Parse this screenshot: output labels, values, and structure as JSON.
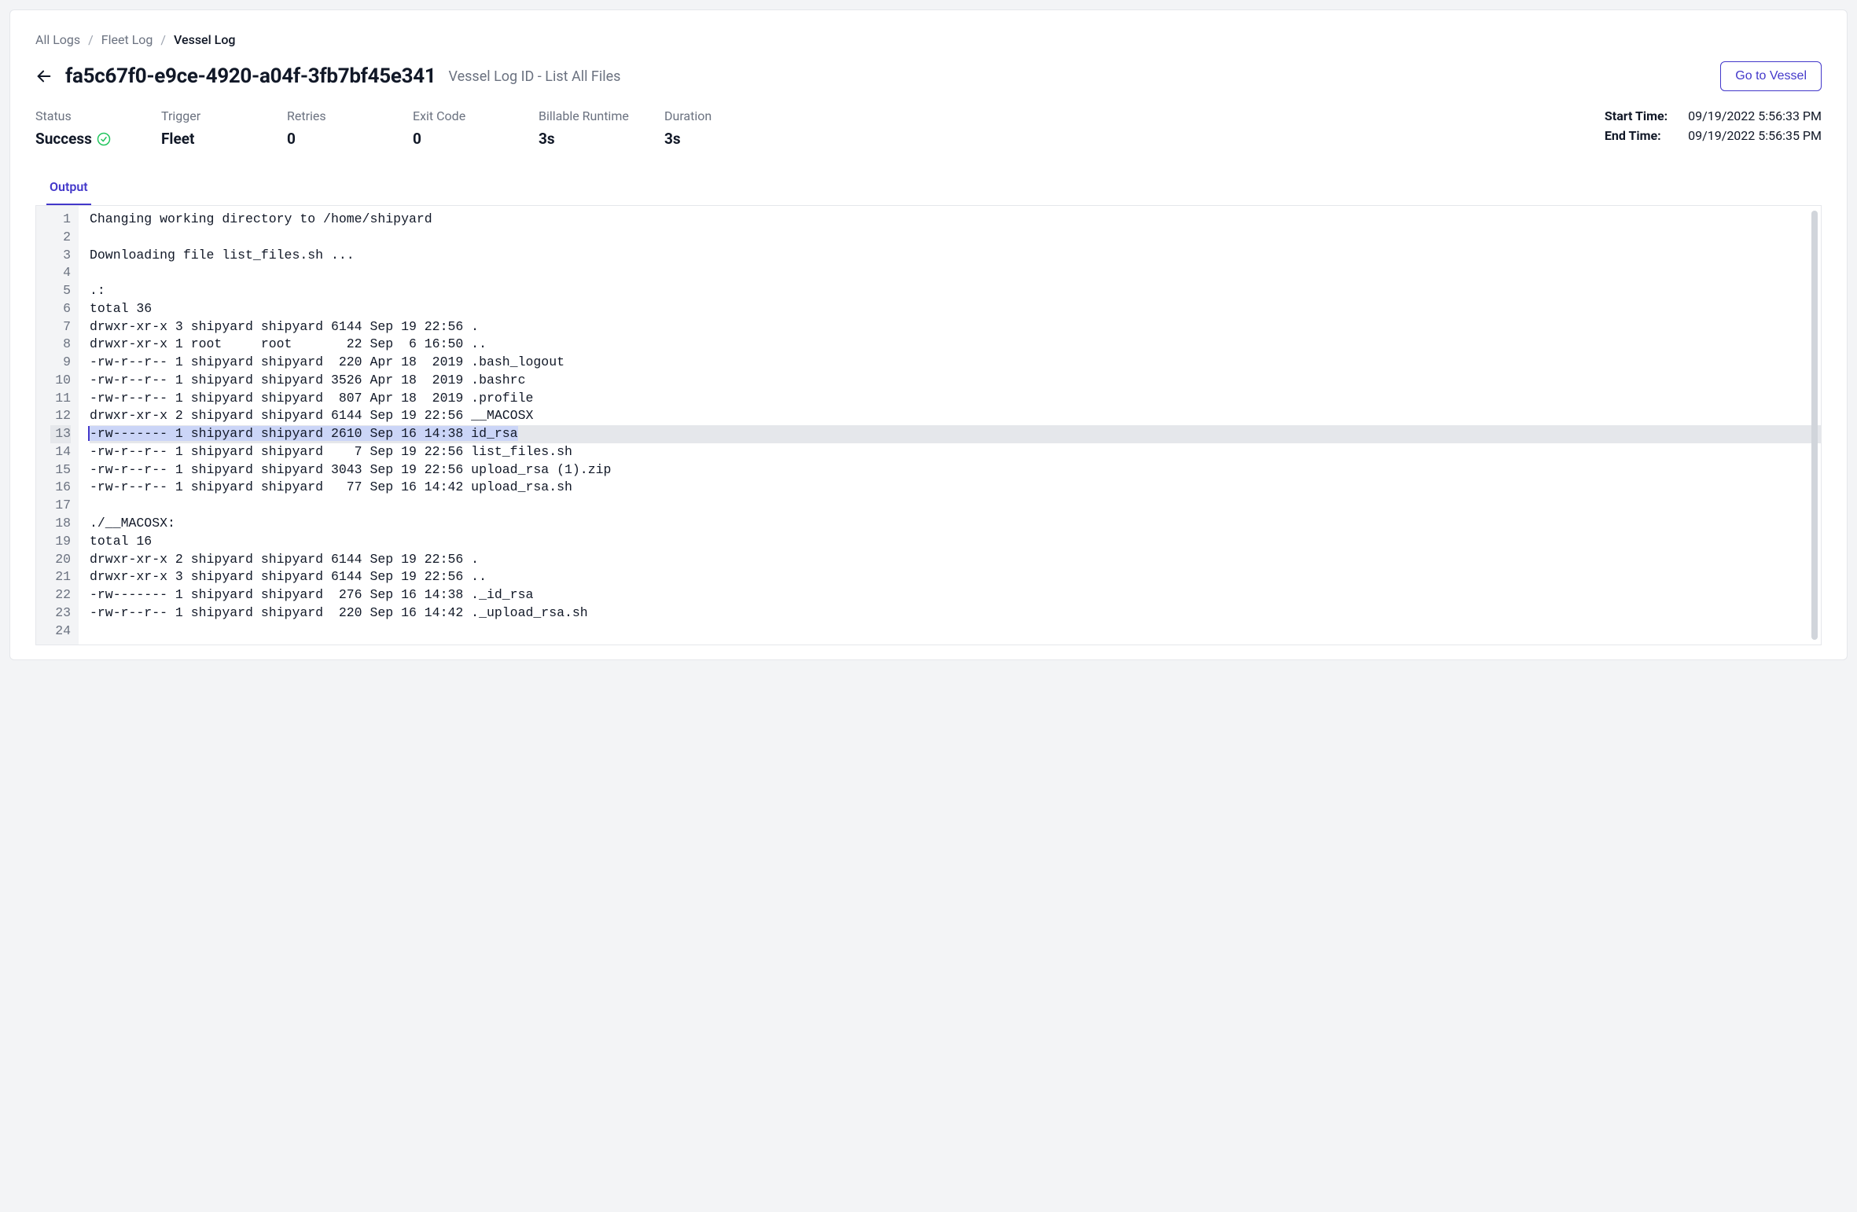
{
  "breadcrumb": {
    "items": [
      "All Logs",
      "Fleet Log",
      "Vessel Log"
    ]
  },
  "header": {
    "title": "fa5c67f0-e9ce-4920-a04f-3fb7bf45e341",
    "subtitle": "Vessel Log ID - List All Files",
    "go_to_vessel": "Go to Vessel"
  },
  "stats": {
    "status_label": "Status",
    "status_value": "Success",
    "trigger_label": "Trigger",
    "trigger_value": "Fleet",
    "retries_label": "Retries",
    "retries_value": "0",
    "exit_code_label": "Exit Code",
    "exit_code_value": "0",
    "billable_label": "Billable Runtime",
    "billable_value": "3s",
    "duration_label": "Duration",
    "duration_value": "3s"
  },
  "times": {
    "start_label": "Start Time:",
    "start_value": "09/19/2022 5:56:33 PM",
    "end_label": "End Time:",
    "end_value": "09/19/2022 5:56:35 PM"
  },
  "tabs": {
    "output": "Output"
  },
  "log": {
    "highlighted_line": 13,
    "lines": [
      "Changing working directory to /home/shipyard",
      "",
      "Downloading file list_files.sh ...",
      "",
      ".:",
      "total 36",
      "drwxr-xr-x 3 shipyard shipyard 6144 Sep 19 22:56 .",
      "drwxr-xr-x 1 root     root       22 Sep  6 16:50 ..",
      "-rw-r--r-- 1 shipyard shipyard  220 Apr 18  2019 .bash_logout",
      "-rw-r--r-- 1 shipyard shipyard 3526 Apr 18  2019 .bashrc",
      "-rw-r--r-- 1 shipyard shipyard  807 Apr 18  2019 .profile",
      "drwxr-xr-x 2 shipyard shipyard 6144 Sep 19 22:56 __MACOSX",
      "-rw------- 1 shipyard shipyard 2610 Sep 16 14:38 id_rsa",
      "-rw-r--r-- 1 shipyard shipyard    7 Sep 19 22:56 list_files.sh",
      "-rw-r--r-- 1 shipyard shipyard 3043 Sep 19 22:56 upload_rsa (1).zip",
      "-rw-r--r-- 1 shipyard shipyard   77 Sep 16 14:42 upload_rsa.sh",
      "",
      "./__MACOSX:",
      "total 16",
      "drwxr-xr-x 2 shipyard shipyard 6144 Sep 19 22:56 .",
      "drwxr-xr-x 3 shipyard shipyard 6144 Sep 19 22:56 ..",
      "-rw------- 1 shipyard shipyard  276 Sep 16 14:38 ._id_rsa",
      "-rw-r--r-- 1 shipyard shipyard  220 Sep 16 14:42 ._upload_rsa.sh",
      ""
    ]
  }
}
